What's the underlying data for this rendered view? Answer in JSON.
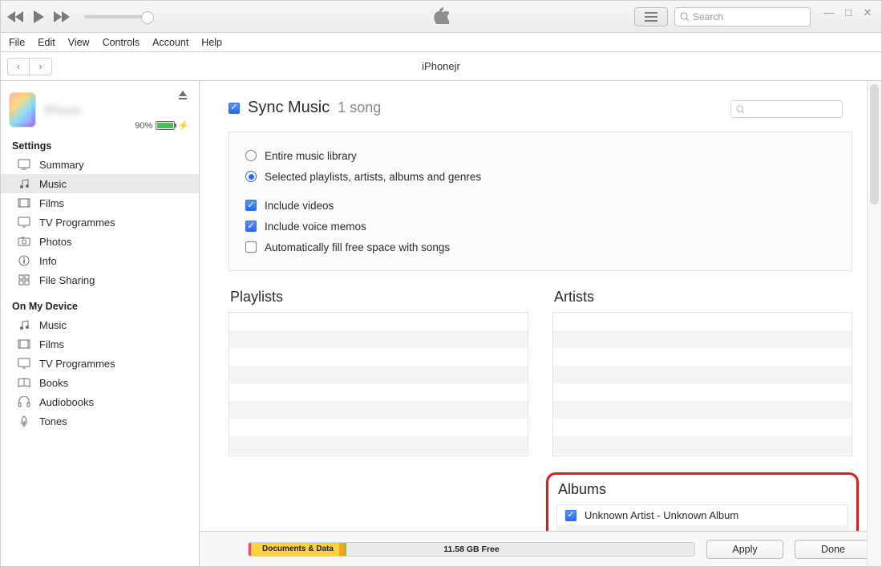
{
  "menu": {
    "file": "File",
    "edit": "Edit",
    "view": "View",
    "controls": "Controls",
    "account": "Account",
    "help": "Help"
  },
  "search_placeholder": "Search",
  "nav": {
    "device_title": "iPhonejr"
  },
  "device": {
    "name": "iPhone",
    "battery_pct": "90%"
  },
  "sidebar": {
    "settings_title": "Settings",
    "on_device_title": "On My Device",
    "settings": [
      {
        "label": "Summary",
        "icon": "summary"
      },
      {
        "label": "Music",
        "icon": "music"
      },
      {
        "label": "Films",
        "icon": "films"
      },
      {
        "label": "TV Programmes",
        "icon": "tv"
      },
      {
        "label": "Photos",
        "icon": "photos"
      },
      {
        "label": "Info",
        "icon": "info"
      },
      {
        "label": "File Sharing",
        "icon": "apps"
      }
    ],
    "ondevice": [
      {
        "label": "Music",
        "icon": "music"
      },
      {
        "label": "Films",
        "icon": "films"
      },
      {
        "label": "TV Programmes",
        "icon": "tv"
      },
      {
        "label": "Books",
        "icon": "books"
      },
      {
        "label": "Audiobooks",
        "icon": "audiobooks"
      },
      {
        "label": "Tones",
        "icon": "tones"
      }
    ]
  },
  "sync": {
    "title": "Sync Music",
    "count": "1 song",
    "opts": {
      "entire": "Entire music library",
      "selected": "Selected playlists, artists, albums and genres",
      "videos": "Include videos",
      "memos": "Include voice memos",
      "autofill": "Automatically fill free space with songs"
    },
    "col_playlists": "Playlists",
    "col_artists": "Artists",
    "col_albums": "Albums",
    "album_entry": "Unknown Artist - Unknown Album"
  },
  "footer": {
    "docs": "Documents & Data",
    "free": "11.58 GB Free",
    "apply": "Apply",
    "done": "Done"
  }
}
